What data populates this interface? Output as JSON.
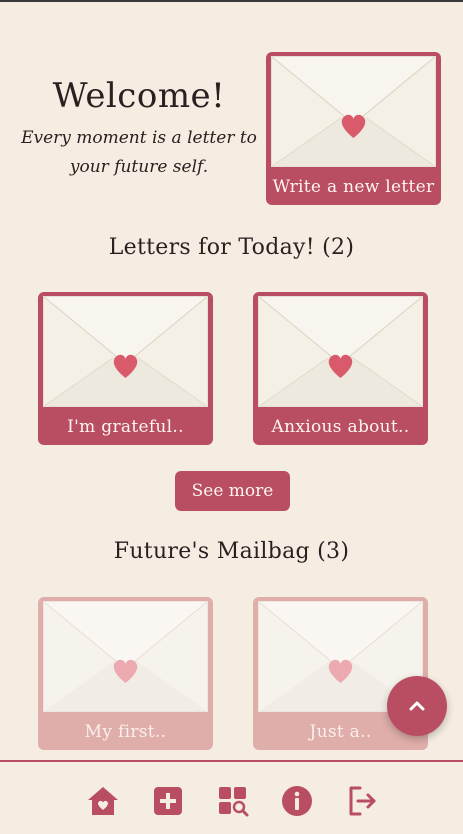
{
  "welcome": {
    "title": "Welcome!",
    "subtitle": "Every moment is a letter to your future self."
  },
  "write_card": {
    "label": "Write a new letter",
    "icon": "envelope-heart-icon"
  },
  "today": {
    "title": "Letters for Today! (2)",
    "letters": [
      {
        "label": "I'm grateful.."
      },
      {
        "label": "Anxious about.."
      }
    ],
    "see_more_label": "See more"
  },
  "mailbag": {
    "title": "Future's Mailbag (3)",
    "letters": [
      {
        "label": "My first.."
      },
      {
        "label": "Just a.."
      }
    ]
  },
  "fab": {
    "icon": "chevron-up-icon"
  },
  "bottom_nav": {
    "items": [
      {
        "icon": "home-heart-icon"
      },
      {
        "icon": "add-square-icon"
      },
      {
        "icon": "grid-search-icon"
      },
      {
        "icon": "info-icon"
      },
      {
        "icon": "logout-icon"
      }
    ]
  },
  "colors": {
    "background": "#f5ede2",
    "accent": "#b94e63",
    "accent_faded": "#dfaeaa",
    "envelope": "#f4f0e6",
    "heart": "#d95a6a"
  }
}
